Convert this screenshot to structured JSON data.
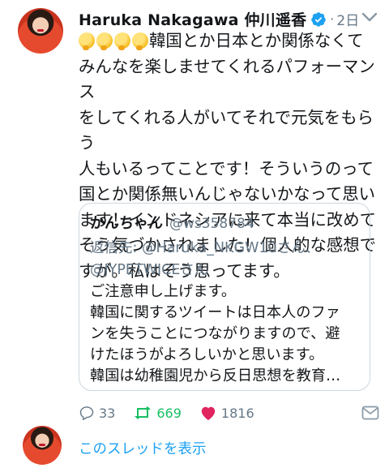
{
  "tweet": {
    "display_name": "Haruka Nakagawa 仲川遥香",
    "time": "2日",
    "text_after_emoji": "韓国とか日本とか関係なくて\nみんなを楽しませてくれるパフォーマンス\nをしてくれる人がいてそれで元気をもらう\n人もいるってことです！そういうのって\n国とか関係無いんじゃないかなって思い\nます！インドネシアに来て本当に改めて\nそう気づかされました！個人的な感想で\nすが。私はそう思ってます。",
    "emoji_icons": [
      "thinking-face-icon",
      "thinking-face-icon",
      "thinking-face-icon",
      "thinking-face-icon"
    ]
  },
  "quote": {
    "name": "かんちゃん",
    "handle": "@ws358784",
    "reply_prefix": "返信先: ",
    "reply_mention_1": "@Haruka_NKGW10",
    "reply_mid": "さん、",
    "reply_mention_2": "@JYPETWICE",
    "reply_suffix": "さん",
    "body": "ご注意申し上げます。\n韓国に関するツイートは日本人のファ\nンを失うことにつながりますので、避\nけたほうがよろしいかと思います。\n韓国は幼稚園児から反日思想を教育…"
  },
  "actions": {
    "reply_count": "33",
    "retweet_count": "669",
    "like_count": "1816"
  },
  "thread_link": "このスレッドを表示",
  "colors": {
    "accent": "#1da1f2",
    "retweet": "#17bf63",
    "like": "#e0245e",
    "muted": "#657786"
  }
}
